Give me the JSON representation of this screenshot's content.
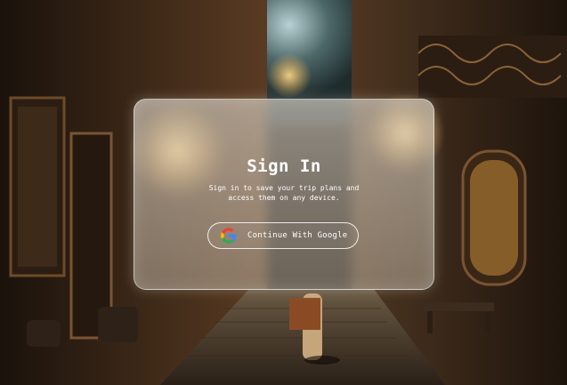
{
  "signin": {
    "title": "Sign In",
    "subtitle": "Sign in to save your trip plans and access them on any device.",
    "google_button_label": "Continue With Google"
  },
  "icons": {
    "google": "google-g-logo"
  },
  "colors": {
    "text": "#ffffff",
    "card_tint": "#d8cfc0",
    "google_red": "#ea4335",
    "google_yellow": "#fbbc05",
    "google_green": "#34a853",
    "google_blue": "#4285f4"
  }
}
